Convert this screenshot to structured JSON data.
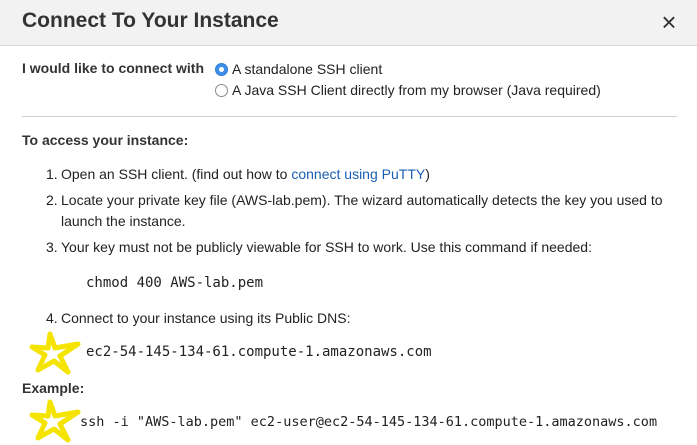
{
  "dialog": {
    "title": "Connect To Your Instance",
    "close_label": "×"
  },
  "connect_with": {
    "label": "I would like to connect with",
    "options": [
      {
        "label": "A standalone SSH client",
        "selected": true
      },
      {
        "label": "A Java SSH Client directly from my browser (Java required)",
        "selected": false
      }
    ]
  },
  "access": {
    "heading": "To access your instance:",
    "steps": [
      {
        "num": "1.",
        "text_before": "Open an SSH client. (find out how to ",
        "link": "connect using PuTTY",
        "text_after": ")"
      },
      {
        "num": "2.",
        "line1": "Locate your private key file (AWS-lab.pem). The wizard automatically detects the key you used to",
        "line2": "launch the instance."
      },
      {
        "num": "3.",
        "text": "Your key must not be publicly viewable for SSH to work. Use this command if needed:"
      },
      {
        "num": "4.",
        "text": "Connect to your instance using its Public DNS:"
      }
    ],
    "chmod_command": "chmod 400 AWS-lab.pem",
    "public_dns": "ec2-54-145-134-61.compute-1.amazonaws.com"
  },
  "example": {
    "label": "Example:",
    "command": "ssh -i \"AWS-lab.pem\" ec2-user@ec2-54-145-134-61.compute-1.amazonaws.com"
  },
  "colors": {
    "header_bg": "#f2f2f2",
    "link": "#1a5fb4",
    "radio_selected": "#3d8fe5",
    "star_annotation": "#f5e400"
  },
  "icons": [
    "close-icon",
    "star-annotation-icon"
  ]
}
